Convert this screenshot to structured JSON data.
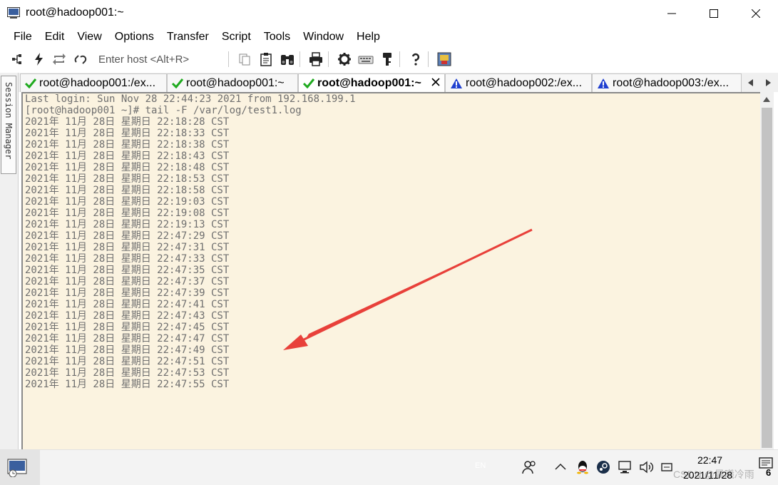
{
  "window": {
    "title": "root@hadoop001:~",
    "minimize_icon": "minimize-icon",
    "maximize_icon": "maximize-icon",
    "close_icon": "close-icon"
  },
  "menu": [
    "File",
    "Edit",
    "View",
    "Options",
    "Transfer",
    "Script",
    "Tools",
    "Window",
    "Help"
  ],
  "toolbar": {
    "host_placeholder": "Enter host <Alt+R>",
    "icons": [
      "connect-icon",
      "quick-connect-lightning-icon",
      "reconnect-icon",
      "disconnect-icon",
      "copy-icon",
      "paste-icon",
      "find-icon",
      "print-icon",
      "settings-gear-icon",
      "keymap-icon",
      "key-icon",
      "help-icon",
      "sftp-icon"
    ]
  },
  "session_manager": {
    "label": "Session Manager"
  },
  "tabs": [
    {
      "label": "root@hadoop001:/ex...",
      "status": "connected",
      "active": false
    },
    {
      "label": "root@hadoop001:~",
      "status": "connected",
      "active": false
    },
    {
      "label": "root@hadoop001:~",
      "status": "connected",
      "active": true
    },
    {
      "label": "root@hadoop002:/ex...",
      "status": "warning",
      "active": false
    },
    {
      "label": "root@hadoop003:/ex...",
      "status": "warning",
      "active": false
    }
  ],
  "terminal": {
    "lines": [
      "Last login: Sun Nov 28 22:44:23 2021 from 192.168.199.1",
      "[root@hadoop001 ~]# tail -F /var/log/test1.log",
      "2021年 11月 28日 星期日 22:18:28 CST",
      "2021年 11月 28日 星期日 22:18:33 CST",
      "2021年 11月 28日 星期日 22:18:38 CST",
      "2021年 11月 28日 星期日 22:18:43 CST",
      "2021年 11月 28日 星期日 22:18:48 CST",
      "2021年 11月 28日 星期日 22:18:53 CST",
      "2021年 11月 28日 星期日 22:18:58 CST",
      "2021年 11月 28日 星期日 22:19:03 CST",
      "2021年 11月 28日 星期日 22:19:08 CST",
      "2021年 11月 28日 星期日 22:19:13 CST",
      "2021年 11月 28日 星期日 22:47:29 CST",
      "2021年 11月 28日 星期日 22:47:31 CST",
      "2021年 11月 28日 星期日 22:47:33 CST",
      "2021年 11月 28日 星期日 22:47:35 CST",
      "2021年 11月 28日 星期日 22:47:37 CST",
      "2021年 11月 28日 星期日 22:47:39 CST",
      "2021年 11月 28日 星期日 22:47:41 CST",
      "2021年 11月 28日 星期日 22:47:43 CST",
      "2021年 11月 28日 星期日 22:47:45 CST",
      "2021年 11月 28日 星期日 22:47:47 CST",
      "2021年 11月 28日 星期日 22:47:49 CST",
      "2021年 11月 28日 星期日 22:47:51 CST",
      "2021年 11月 28日 星期日 22:47:53 CST",
      "2021年 11月 28日 星期日 22:47:55 CST"
    ],
    "background": "#fbf3e0",
    "text_color": "#6f6f6f"
  },
  "annotation": {
    "arrow_color": "#e8403a"
  },
  "taskbar": {
    "lang": "EN",
    "time": "22:47",
    "date": "2021/11/28",
    "watermark": "CSDN @晨曦冷雨",
    "notification_count": "6",
    "tray_icons": [
      "people-icon",
      "chevron-up-icon",
      "qq-icon",
      "steam-icon",
      "network-icon",
      "volume-icon",
      "input-method-icon",
      "notification-icon"
    ]
  },
  "colors": {
    "check_green": "#1faa1f",
    "warning_blue": "#1f3fd0",
    "scroll_thumb": "#c3c3c3"
  }
}
